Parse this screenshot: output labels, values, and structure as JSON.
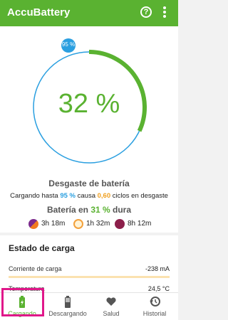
{
  "app": {
    "title": "AccuBattery",
    "help_glyph": "?"
  },
  "gauge": {
    "percent_label": "32 %",
    "level": 0.32,
    "badge_label": "95 %",
    "target_level": 0.95
  },
  "wear": {
    "title": "Desgaste de batería",
    "prefix": "Cargando hasta ",
    "target": "95 %",
    "middle": " causa ",
    "cycles": "0,60",
    "suffix": " ciclos en desgaste"
  },
  "duration": {
    "prefix": "Batería en ",
    "level": "31 %",
    "suffix": " dura"
  },
  "times": [
    {
      "icon": "screen-on-icon",
      "value": "3h 18m"
    },
    {
      "icon": "sun-icon",
      "value": "1h 32m"
    },
    {
      "icon": "sleep-icon",
      "value": "8h 12m"
    }
  ],
  "charge_state": {
    "title": "Estado de carga",
    "rows": [
      {
        "label": "Corriente de carga",
        "value": "-238 mA"
      },
      {
        "label": "Temperatura",
        "value": "24,5 °C"
      }
    ]
  },
  "nav": [
    {
      "label": "Cargando",
      "icon": "battery-charging-icon",
      "active": true
    },
    {
      "label": "Descargando",
      "icon": "battery-icon",
      "active": false
    },
    {
      "label": "Salud",
      "icon": "heart-icon",
      "active": false
    },
    {
      "label": "Historial",
      "icon": "history-icon",
      "active": false
    }
  ],
  "colors": {
    "accent": "#5ab231",
    "blue": "#2a9fe0",
    "orange": "#f0a020",
    "highlight": "#e0188a"
  }
}
